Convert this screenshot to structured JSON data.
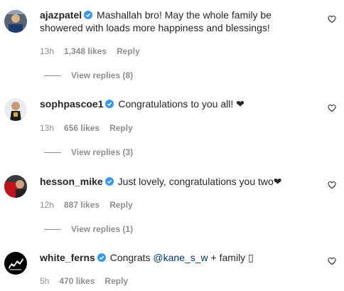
{
  "comments": [
    {
      "username": "ajazpatel",
      "verified": true,
      "text": "Mashallah bro! May the whole family be showered with loads more happiness and blessings!",
      "time": "13h",
      "likes": "1,348 likes",
      "reply": "Reply",
      "view_replies": "View replies (8)"
    },
    {
      "username": "sophpascoe1",
      "verified": true,
      "text": "Congratulations to you all! ❤",
      "time": "13h",
      "likes": "656 likes",
      "reply": "Reply",
      "view_replies": "View replies (3)"
    },
    {
      "username": "hesson_mike",
      "verified": true,
      "text": "Just lovely, congratulations you two❤",
      "time": "12h",
      "likes": "887 likes",
      "reply": "Reply",
      "view_replies": "View replies (1)"
    },
    {
      "username": "white_ferns",
      "verified": true,
      "text_before": "Congrats ",
      "mention": "@kane_s_w",
      "text_after": " + family ▯",
      "time": "5h",
      "likes": "470 likes",
      "reply": "Reply"
    }
  ],
  "colors": {
    "verified": "#3897f0",
    "secondary_text": "#8e8e8e",
    "mention": "#00376b"
  },
  "icons": {
    "like": "heart-outline-icon",
    "verified": "verified-badge-icon"
  }
}
